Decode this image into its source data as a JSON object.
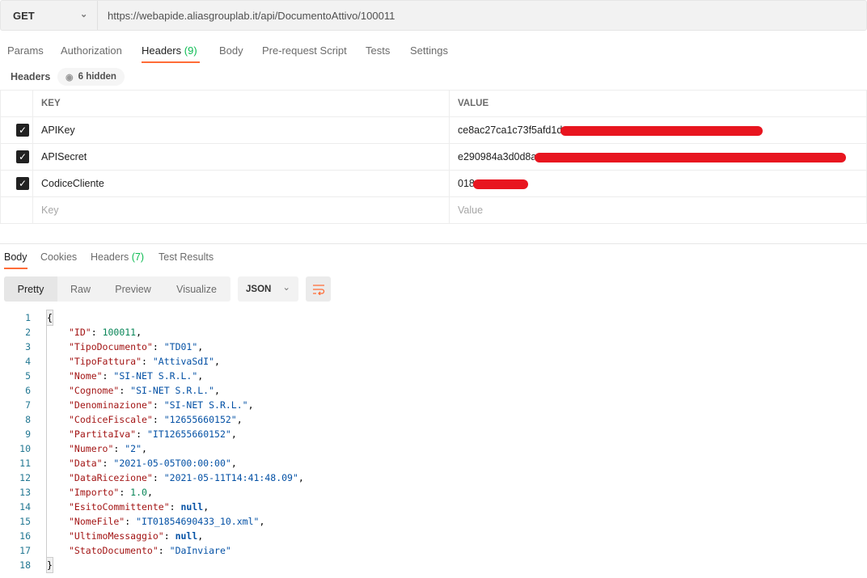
{
  "request": {
    "method": "GET",
    "url": "https://webapide.aliasgrouplab.it/api/DocumentoAttivo/100011"
  },
  "request_tabs": [
    {
      "label": "Params"
    },
    {
      "label": "Authorization"
    },
    {
      "label": "Headers",
      "count": "(9)"
    },
    {
      "label": "Body"
    },
    {
      "label": "Pre-request Script"
    },
    {
      "label": "Tests"
    },
    {
      "label": "Settings"
    }
  ],
  "headers_section": {
    "label": "Headers",
    "hidden": "6 hidden"
  },
  "headers_table": {
    "columns": [
      "KEY",
      "VALUE"
    ],
    "rows": [
      {
        "key": "APIKey",
        "value": "ce8ac27ca1c73f5afd1d"
      },
      {
        "key": "APISecret",
        "value": "e290984a3d0d8a"
      },
      {
        "key": "CodiceCliente",
        "value": "018"
      }
    ],
    "placeholder_key": "Key",
    "placeholder_value": "Value"
  },
  "response_tabs": [
    {
      "label": "Body"
    },
    {
      "label": "Cookies"
    },
    {
      "label": "Headers",
      "count": "(7)"
    },
    {
      "label": "Test Results"
    }
  ],
  "view_modes": [
    "Pretty",
    "Raw",
    "Preview",
    "Visualize"
  ],
  "format": "JSON",
  "colors": {
    "accent": "#ff6c37",
    "count": "#0cbb52",
    "redaction": "#e8151f"
  },
  "code_lines": [
    {
      "n": "1",
      "t": "{"
    },
    {
      "n": "2",
      "k": "\"ID\"",
      "v": "100011",
      "vt": "n",
      "c": ","
    },
    {
      "n": "3",
      "k": "\"TipoDocumento\"",
      "v": "\"TD01\"",
      "vt": "s",
      "c": ","
    },
    {
      "n": "4",
      "k": "\"TipoFattura\"",
      "v": "\"AttivaSdI\"",
      "vt": "s",
      "c": ","
    },
    {
      "n": "5",
      "k": "\"Nome\"",
      "v": "\"SI-NET S.R.L.\"",
      "vt": "s",
      "c": ","
    },
    {
      "n": "6",
      "k": "\"Cognome\"",
      "v": "\"SI-NET S.R.L.\"",
      "vt": "s",
      "c": ","
    },
    {
      "n": "7",
      "k": "\"Denominazione\"",
      "v": "\"SI-NET S.R.L.\"",
      "vt": "s",
      "c": ","
    },
    {
      "n": "8",
      "k": "\"CodiceFiscale\"",
      "v": "\"12655660152\"",
      "vt": "s",
      "c": ","
    },
    {
      "n": "9",
      "k": "\"PartitaIva\"",
      "v": "\"IT12655660152\"",
      "vt": "s",
      "c": ","
    },
    {
      "n": "10",
      "k": "\"Numero\"",
      "v": "\"2\"",
      "vt": "s",
      "c": ","
    },
    {
      "n": "11",
      "k": "\"Data\"",
      "v": "\"2021-05-05T00:00:00\"",
      "vt": "s",
      "c": ","
    },
    {
      "n": "12",
      "k": "\"DataRicezione\"",
      "v": "\"2021-05-11T14:41:48.09\"",
      "vt": "s",
      "c": ","
    },
    {
      "n": "13",
      "k": "\"Importo\"",
      "v": "1.0",
      "vt": "n",
      "c": ","
    },
    {
      "n": "14",
      "k": "\"EsitoCommittente\"",
      "v": "null",
      "vt": "nl",
      "c": ","
    },
    {
      "n": "15",
      "k": "\"NomeFile\"",
      "v": "\"IT01854690433_10.xml\"",
      "vt": "s",
      "c": ","
    },
    {
      "n": "16",
      "k": "\"UltimoMessaggio\"",
      "v": "null",
      "vt": "nl",
      "c": ","
    },
    {
      "n": "17",
      "k": "\"StatoDocumento\"",
      "v": "\"DaInviare\"",
      "vt": "s",
      "c": ""
    },
    {
      "n": "18",
      "t": "}"
    }
  ]
}
